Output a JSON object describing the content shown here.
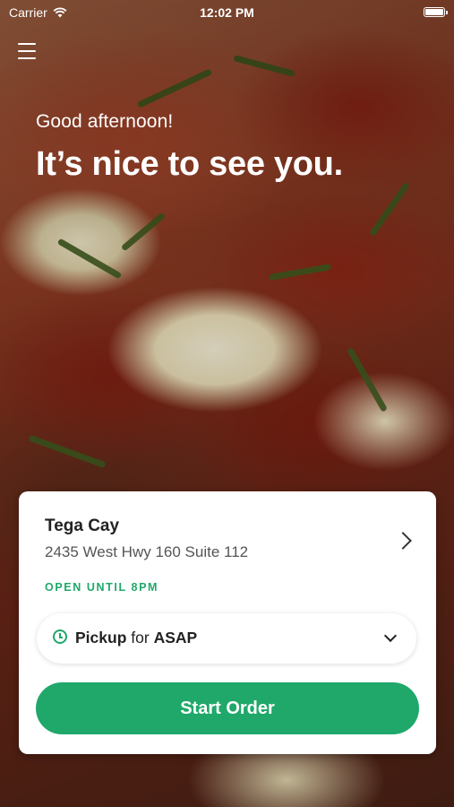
{
  "status_bar": {
    "carrier": "Carrier",
    "time": "12:02 PM"
  },
  "greeting": {
    "subtitle": "Good afternoon!",
    "title": "It’s nice to see you."
  },
  "location": {
    "name": "Tega Cay",
    "address": "2435 West Hwy 160 Suite 112",
    "hours_status": "OPEN UNTIL 8PM"
  },
  "order": {
    "mode": "Pickup",
    "connector": "for",
    "timing": "ASAP"
  },
  "actions": {
    "start_order": "Start Order"
  },
  "colors": {
    "accent": "#1fa86a"
  }
}
